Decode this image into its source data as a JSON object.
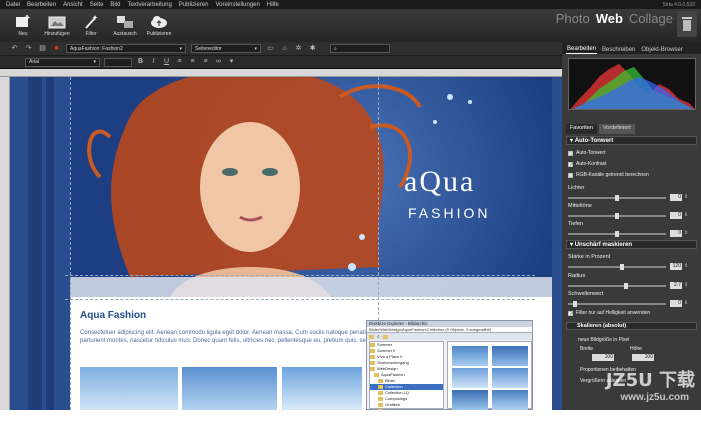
{
  "menu": [
    "Datei",
    "Bearbeiten",
    "Ansicht",
    "Seite",
    "Bild",
    "Textverarbeitung",
    "Publizieren",
    "Voreinstellungen",
    "Hilfe"
  ],
  "version": "Sirta 4.0.0.532",
  "toolbar": [
    {
      "label": "Neu",
      "icon": "new-page-icon"
    },
    {
      "label": "Hinzufügen",
      "icon": "add-image-icon"
    },
    {
      "label": "Filter",
      "icon": "wand-icon"
    },
    {
      "label": "Austausch",
      "icon": "exchange-icon"
    },
    {
      "label": "Publizieren",
      "icon": "cloud-upload-icon"
    }
  ],
  "modes": {
    "photo": "Photo",
    "web": "Web",
    "collage": "Collage"
  },
  "subbar": {
    "project": "AquaFashion: Fashion2",
    "editor": "Seiteneditor"
  },
  "fontbar": {
    "font": "Arial"
  },
  "page": {
    "logo_line1": "aQua",
    "logo_line2": "FASHION",
    "heading": "Aqua Fashion",
    "body": "Consectetuer adipiscing elit. Aenean commodo ligula eget dolor. Aenean massa. Cum sociis natoque penatibus et magnis dis parturient montes, nascetur ridiculus mus. Donec quam felis, ultricies nec, pellentesque eu, pretium quis, sem."
  },
  "right_panel": {
    "tabs": [
      "Bearbeiten",
      "Beschreiben",
      "Objekt-Browser"
    ],
    "fav_tabs": [
      "Favoriten",
      "Vordefiniert"
    ],
    "auto_tonwert": {
      "title": "Auto-Tonwert",
      "checks": [
        {
          "label": "Auto-Tonwert",
          "checked": false
        },
        {
          "label": "Auto-Kontrast",
          "checked": true
        },
        {
          "label": "RGB-Kanäle getrennt berechnen",
          "checked": false
        }
      ],
      "sliders": [
        {
          "label": "Lichter",
          "value": "0",
          "level": 0.5
        },
        {
          "label": "Mitteltöne",
          "value": "0",
          "level": 0.5
        },
        {
          "label": "Tiefen",
          "value": "0",
          "level": 0.5
        }
      ]
    },
    "unschaerf": {
      "title": "Unschärf maskieren",
      "sliders": [
        {
          "label": "Stärke in Prozent",
          "value": "120",
          "level": 0.55
        },
        {
          "label": "Radius",
          "value": "2.7",
          "level": 0.6
        },
        {
          "label": "Schwellenwert",
          "value": "0",
          "level": 0.05
        }
      ],
      "check": {
        "label": "Filter nur auf Helligkeit anwenden",
        "checked": true
      }
    },
    "skalieren": {
      "title": "Skalieren (absolut)",
      "unit_text": "neue Bildgröße in Pixel",
      "width_label": "Breite",
      "height_label": "Höhe",
      "width": "100",
      "height": "100",
      "keep_label": "Proportionen beibehalten",
      "extra_label": "Vergrößern zulassen"
    }
  },
  "explorer": {
    "title": "Diskbize Explorer - Bildarchiv",
    "path": "Bilder\\WebDesign\\AquaFashion\\Collection  (9 Objekte, 0 ausgewählt)",
    "tree": [
      "Sommer",
      "Sommer II",
      "Viva a Place II",
      "Sonnenuntergang",
      "WebDesign",
      "AquaFashion",
      "Bilder",
      "Collection",
      "Collection LQ",
      "Composings",
      "Grafiken",
      "Logos"
    ],
    "selected": "Collection"
  },
  "watermark": {
    "line1": "JZ5U 下载",
    "line2": "www.jz5u.com"
  },
  "colors": {
    "accent": "#1f4e8c",
    "canvas_bg": "#2a4d8f"
  }
}
